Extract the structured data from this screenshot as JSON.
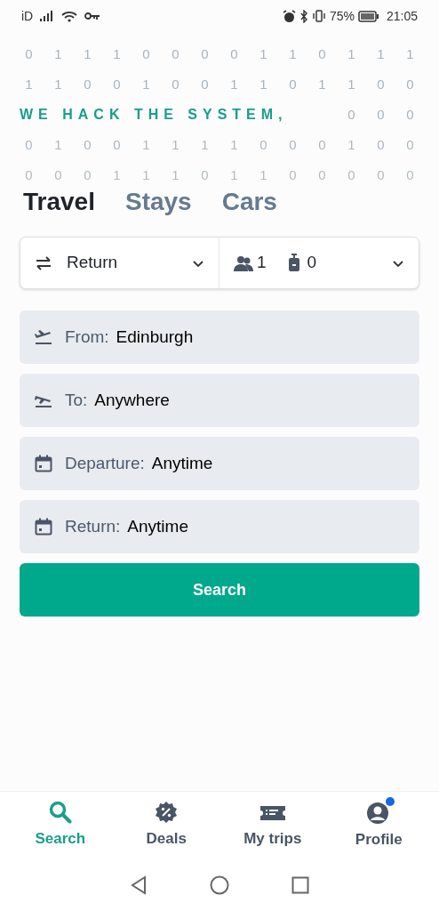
{
  "status_bar": {
    "carrier": "iD",
    "battery_percent": "75%",
    "time": "21:05"
  },
  "banner": {
    "binary_rows": [
      [
        "0",
        "1",
        "1",
        "1",
        "0",
        "0",
        "0",
        "0",
        "1",
        "1",
        "0",
        "1",
        "1",
        "1"
      ],
      [
        "1",
        "1",
        "0",
        "0",
        "1",
        "0",
        "0",
        "1",
        "1",
        "0",
        "1",
        "1",
        "0",
        "0"
      ],
      [
        "0",
        "0",
        "0"
      ],
      [
        "0",
        "1",
        "0",
        "0",
        "1",
        "1",
        "1",
        "1",
        "0",
        "0",
        "0",
        "1",
        "0",
        "0"
      ],
      [
        "0",
        "0",
        "0",
        "1",
        "1",
        "1",
        "0",
        "1",
        "1",
        "0",
        "0",
        "0",
        "0",
        "0"
      ]
    ],
    "tagline": "WE HACK THE SYSTEM,"
  },
  "tabs": [
    {
      "label": "Travel",
      "selected": true
    },
    {
      "label": "Stays",
      "selected": false
    },
    {
      "label": "Cars",
      "selected": false
    }
  ],
  "options": {
    "trip_type": "Return",
    "passengers": "1",
    "bags": "0"
  },
  "fields": [
    {
      "kind": "from",
      "label": "From:",
      "value": "Edinburgh"
    },
    {
      "kind": "to",
      "label": "To:",
      "value": "Anywhere"
    },
    {
      "kind": "date",
      "label": "Departure:",
      "value": "Anytime"
    },
    {
      "kind": "date",
      "label": "Return:",
      "value": "Anytime"
    }
  ],
  "search_button": "Search",
  "bottom_nav": [
    {
      "kind": "search",
      "label": "Search",
      "selected": true,
      "badge": false
    },
    {
      "kind": "deals",
      "label": "Deals",
      "selected": false,
      "badge": false
    },
    {
      "kind": "trips",
      "label": "My trips",
      "selected": false,
      "badge": false
    },
    {
      "kind": "profile",
      "label": "Profile",
      "selected": false,
      "badge": true
    }
  ]
}
